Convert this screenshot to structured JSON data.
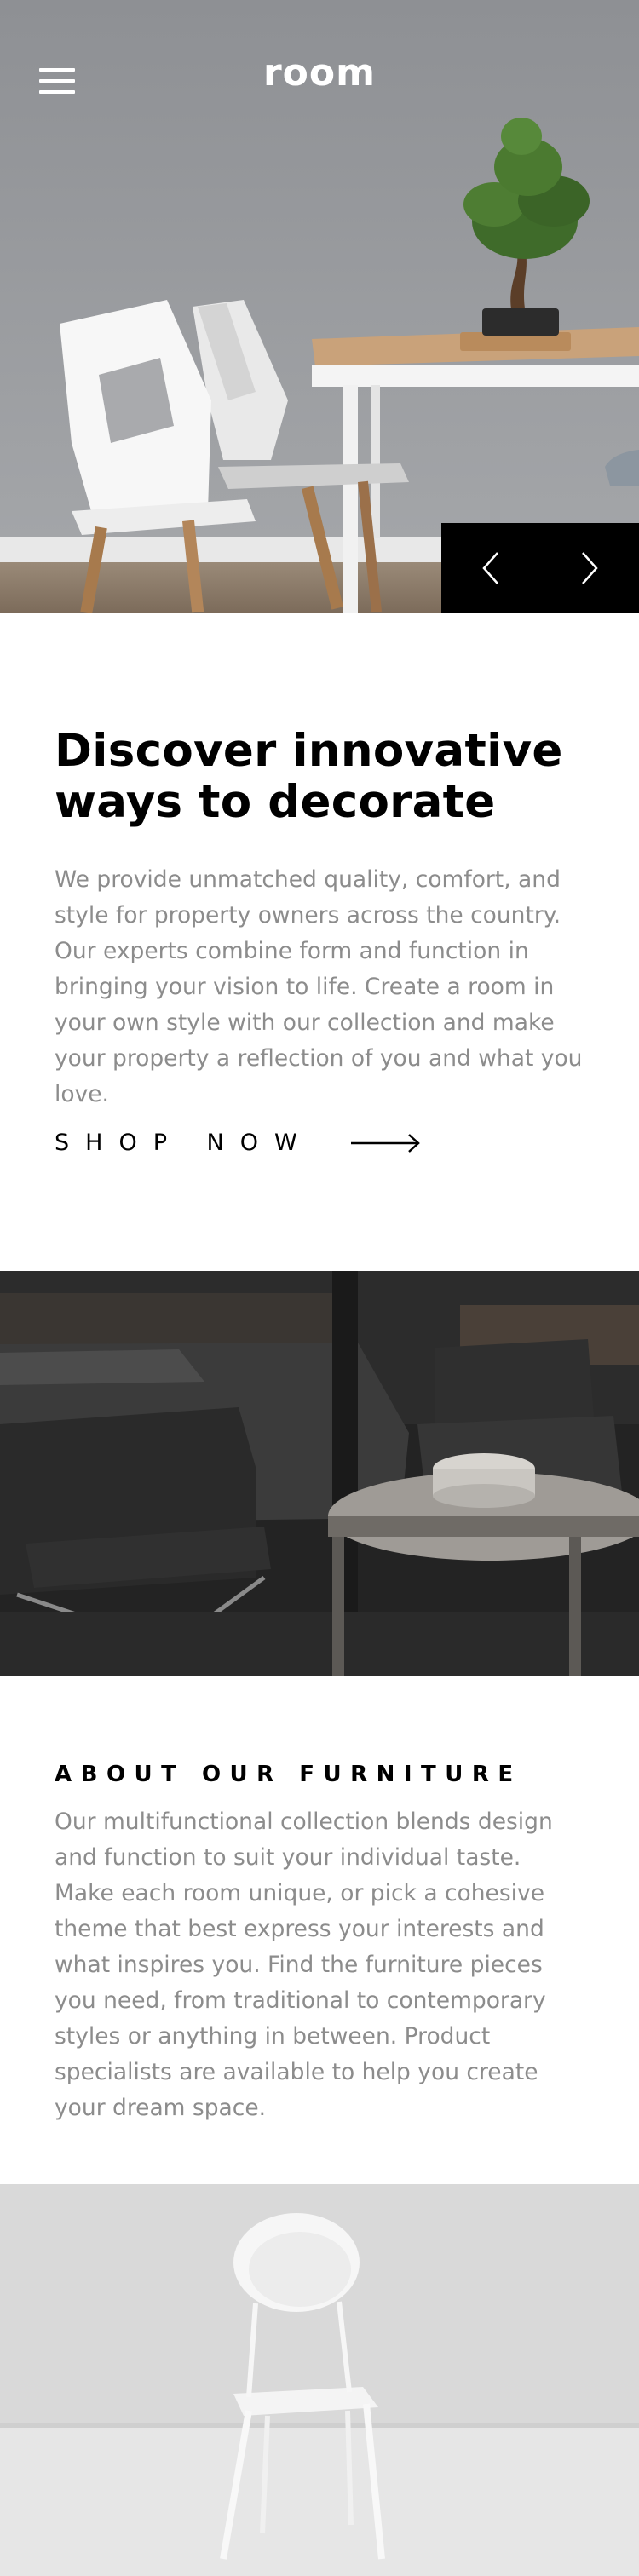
{
  "header": {
    "logo": "room",
    "menu_icon": "hamburger-menu-icon"
  },
  "hero": {
    "prev_icon": "chevron-left-icon",
    "next_icon": "chevron-right-icon"
  },
  "discover": {
    "title_line1": "Discover innovative",
    "title_line2": "ways to decorate",
    "paragraph": "We provide unmatched quality, comfort, and style for property owners across the country. Our experts combine form and function in bringing your vision to life. Create a room in your own style with our collection and make your property a reflection of you and what you love.",
    "cta_label": "SHOP NOW",
    "cta_icon": "arrow-right-icon"
  },
  "about": {
    "title": "ABOUT OUR FURNITURE",
    "paragraph": "Our multifunctional collection blends design and function to suit your individual taste. Make each room unique, or pick a cohesive theme that best express your interests and what inspires you. Find the furniture pieces you need, from traditional to contemporary styles or anything in between. Product specialists are available to help you create your dream space."
  },
  "colors": {
    "text_primary": "#000000",
    "text_muted": "#8c8c8c",
    "nav_bg": "#000000",
    "logo": "#ffffff"
  }
}
